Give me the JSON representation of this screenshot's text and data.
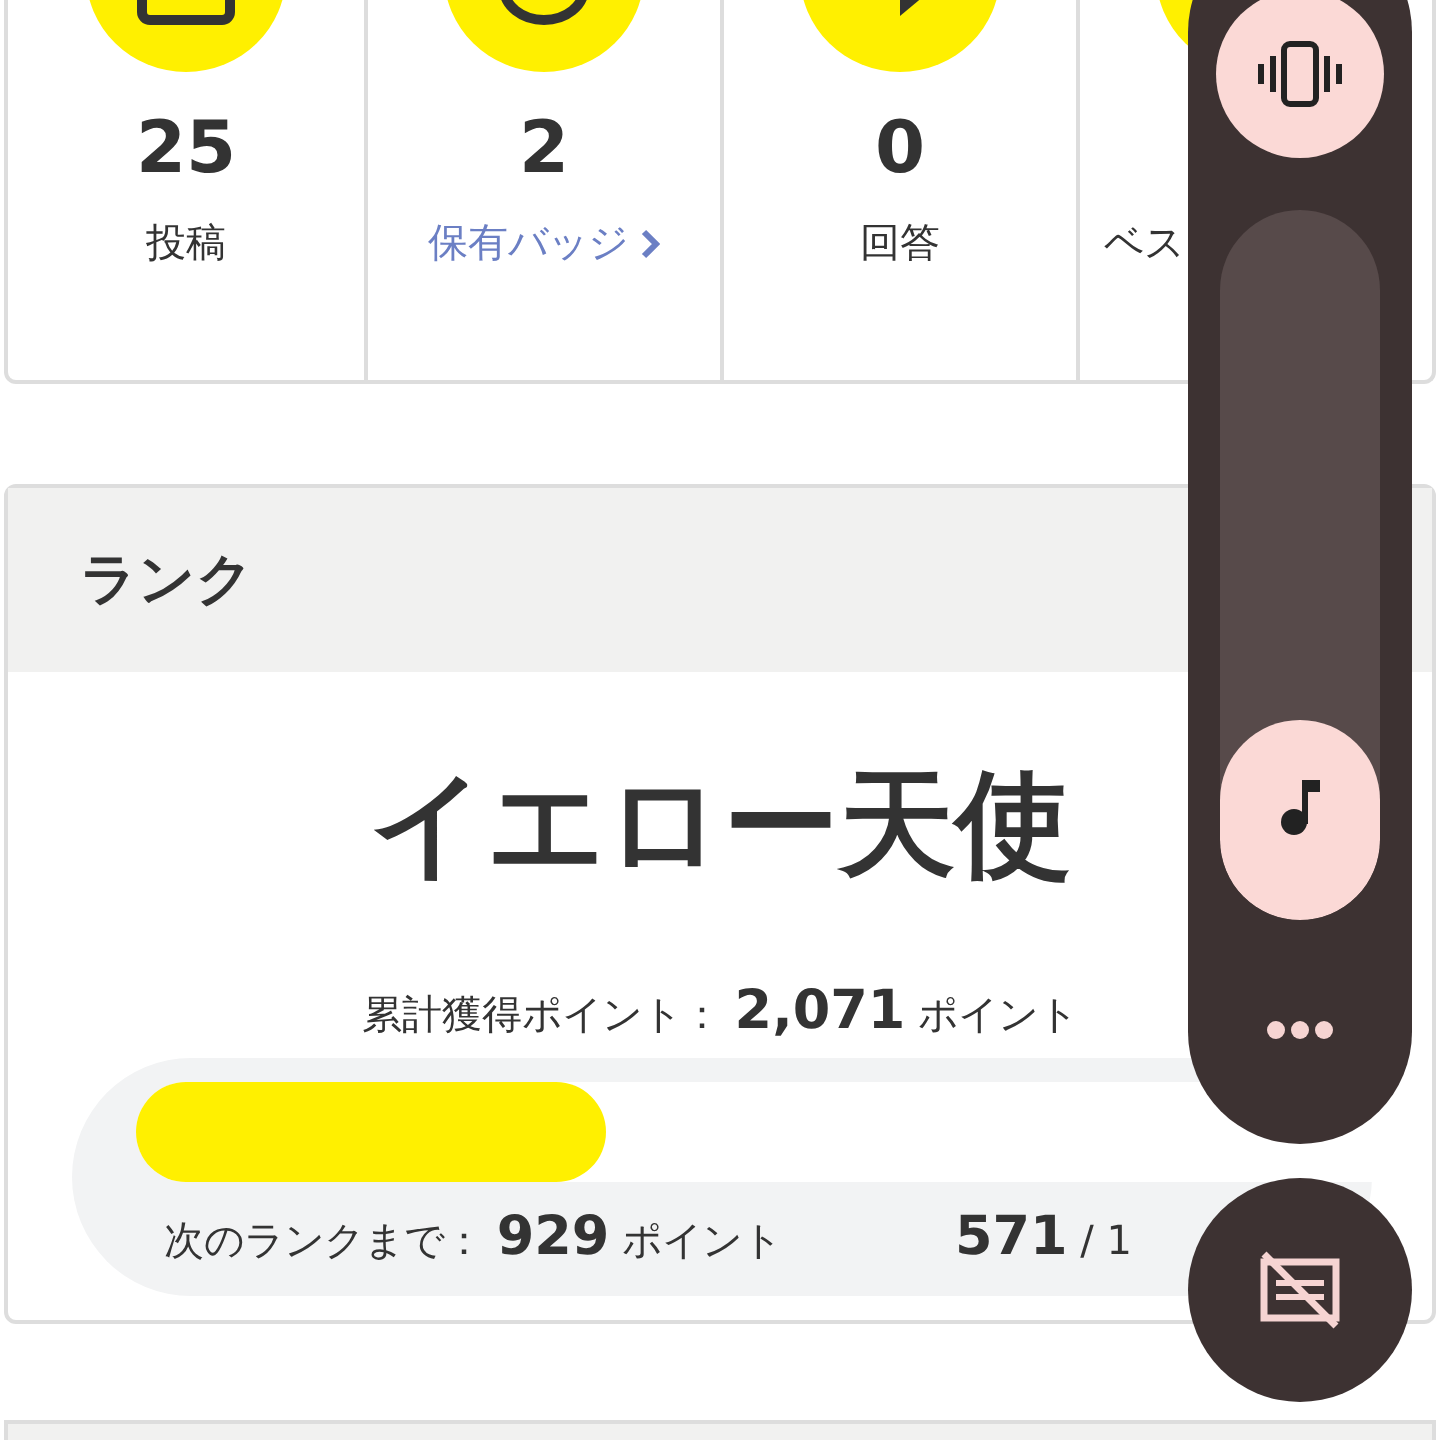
{
  "stats": [
    {
      "value": "25",
      "label": "投稿",
      "kind": "plain"
    },
    {
      "value": "2",
      "label": "保有バッジ",
      "kind": "link"
    },
    {
      "value": "0",
      "label": "回答",
      "kind": "plain"
    },
    {
      "label": "ベス",
      "kind": "plain"
    }
  ],
  "rank": {
    "heading": "ランク",
    "title": "イエロー天使",
    "total_label": "累計獲得ポイント：",
    "total_value": "2,071",
    "total_unit": "ポイント",
    "level": 0.38,
    "next_label": "次のランクまで：",
    "next_value": "929",
    "next_unit": "ポイント",
    "current": "571",
    "max": "/ 1"
  },
  "volume_panel": {
    "level": 0.28
  }
}
